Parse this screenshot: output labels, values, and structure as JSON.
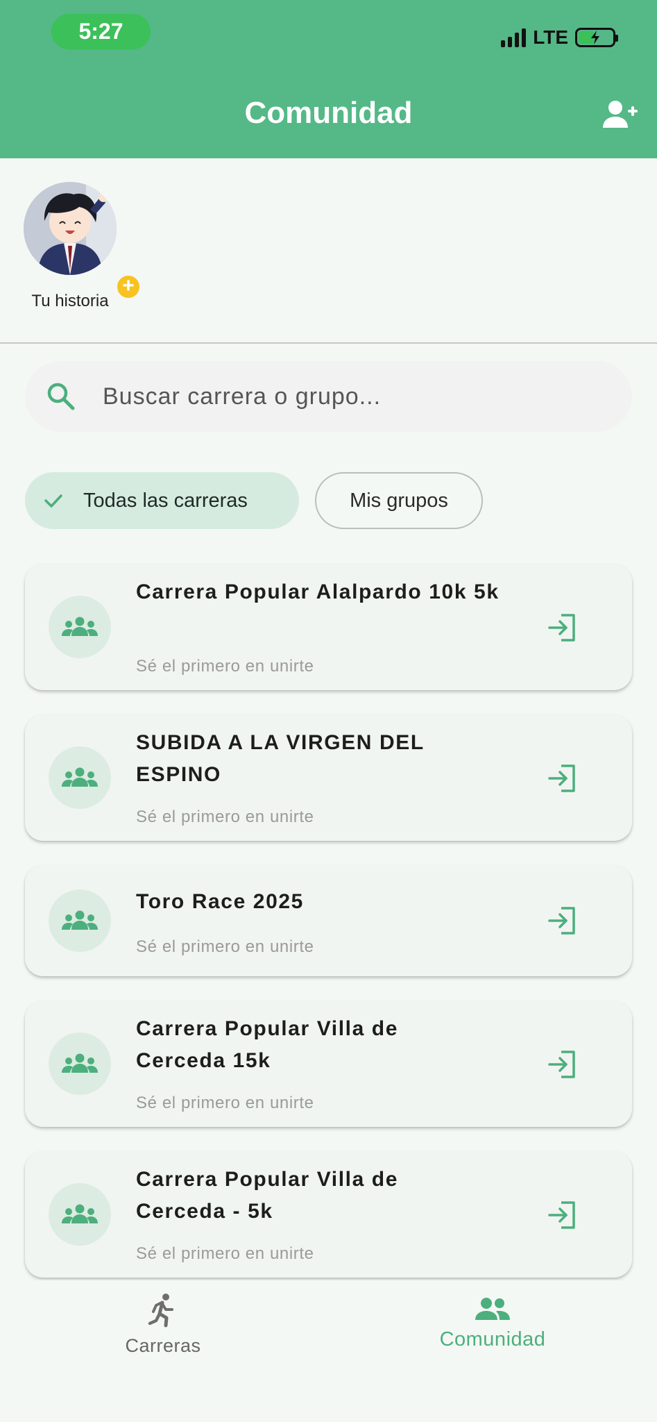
{
  "status_bar": {
    "time": "5:27",
    "network": "LTE"
  },
  "header": {
    "title": "Comunidad",
    "add_friend_icon": "person-add-icon"
  },
  "stories": [
    {
      "label": "Tu historia"
    }
  ],
  "search": {
    "placeholder": "Buscar carrera o grupo..."
  },
  "filters": {
    "all_label": "Todas las carreras",
    "mine_label": "Mis grupos",
    "selected": "all"
  },
  "groups": [
    {
      "name": "Carrera Popular Alalpardo 10k 5k",
      "subtitle": "Sé el primero en unirte"
    },
    {
      "name": "SUBIDA A LA VIRGEN DEL ESPINO",
      "subtitle": "Sé el primero en unirte"
    },
    {
      "name": "Toro Race 2025",
      "subtitle": "Sé el primero en unirte"
    },
    {
      "name": "Carrera Popular Villa de Cerceda 15k",
      "subtitle": "Sé el primero en unirte"
    },
    {
      "name": "Carrera Popular Villa de Cerceda - 5k",
      "subtitle": "Sé el primero en unirte"
    }
  ],
  "bottom_nav": [
    {
      "label": "Carreras",
      "icon": "running-icon",
      "active": false
    },
    {
      "label": "Comunidad",
      "icon": "group-icon",
      "active": true
    }
  ],
  "colors": {
    "primary": "#55b887",
    "status_pill": "#3cc05a",
    "chip_selected": "#d6ebdf",
    "story_badge": "#f7c321"
  }
}
